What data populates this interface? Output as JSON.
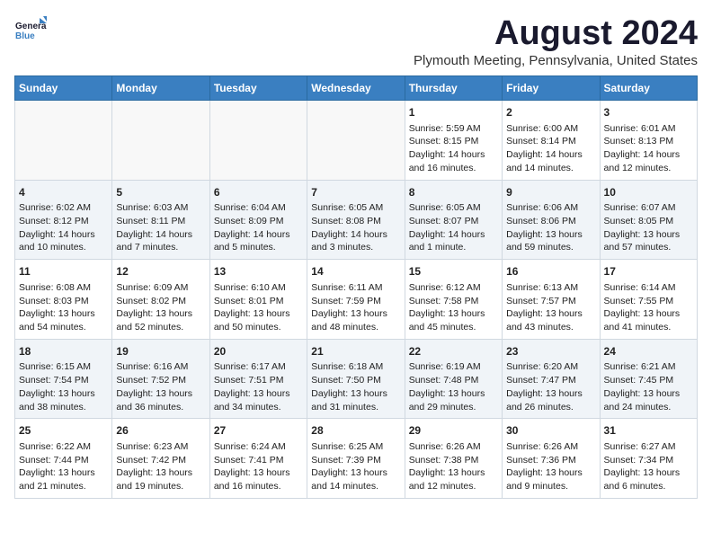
{
  "header": {
    "logo_general": "General",
    "logo_blue": "Blue",
    "title": "August 2024",
    "subtitle": "Plymouth Meeting, Pennsylvania, United States"
  },
  "columns": [
    "Sunday",
    "Monday",
    "Tuesday",
    "Wednesday",
    "Thursday",
    "Friday",
    "Saturday"
  ],
  "weeks": [
    [
      {
        "num": "",
        "content": ""
      },
      {
        "num": "",
        "content": ""
      },
      {
        "num": "",
        "content": ""
      },
      {
        "num": "",
        "content": ""
      },
      {
        "num": "1",
        "content": "Sunrise: 5:59 AM\nSunset: 8:15 PM\nDaylight: 14 hours\nand 16 minutes."
      },
      {
        "num": "2",
        "content": "Sunrise: 6:00 AM\nSunset: 8:14 PM\nDaylight: 14 hours\nand 14 minutes."
      },
      {
        "num": "3",
        "content": "Sunrise: 6:01 AM\nSunset: 8:13 PM\nDaylight: 14 hours\nand 12 minutes."
      }
    ],
    [
      {
        "num": "4",
        "content": "Sunrise: 6:02 AM\nSunset: 8:12 PM\nDaylight: 14 hours\nand 10 minutes."
      },
      {
        "num": "5",
        "content": "Sunrise: 6:03 AM\nSunset: 8:11 PM\nDaylight: 14 hours\nand 7 minutes."
      },
      {
        "num": "6",
        "content": "Sunrise: 6:04 AM\nSunset: 8:09 PM\nDaylight: 14 hours\nand 5 minutes."
      },
      {
        "num": "7",
        "content": "Sunrise: 6:05 AM\nSunset: 8:08 PM\nDaylight: 14 hours\nand 3 minutes."
      },
      {
        "num": "8",
        "content": "Sunrise: 6:05 AM\nSunset: 8:07 PM\nDaylight: 14 hours\nand 1 minute."
      },
      {
        "num": "9",
        "content": "Sunrise: 6:06 AM\nSunset: 8:06 PM\nDaylight: 13 hours\nand 59 minutes."
      },
      {
        "num": "10",
        "content": "Sunrise: 6:07 AM\nSunset: 8:05 PM\nDaylight: 13 hours\nand 57 minutes."
      }
    ],
    [
      {
        "num": "11",
        "content": "Sunrise: 6:08 AM\nSunset: 8:03 PM\nDaylight: 13 hours\nand 54 minutes."
      },
      {
        "num": "12",
        "content": "Sunrise: 6:09 AM\nSunset: 8:02 PM\nDaylight: 13 hours\nand 52 minutes."
      },
      {
        "num": "13",
        "content": "Sunrise: 6:10 AM\nSunset: 8:01 PM\nDaylight: 13 hours\nand 50 minutes."
      },
      {
        "num": "14",
        "content": "Sunrise: 6:11 AM\nSunset: 7:59 PM\nDaylight: 13 hours\nand 48 minutes."
      },
      {
        "num": "15",
        "content": "Sunrise: 6:12 AM\nSunset: 7:58 PM\nDaylight: 13 hours\nand 45 minutes."
      },
      {
        "num": "16",
        "content": "Sunrise: 6:13 AM\nSunset: 7:57 PM\nDaylight: 13 hours\nand 43 minutes."
      },
      {
        "num": "17",
        "content": "Sunrise: 6:14 AM\nSunset: 7:55 PM\nDaylight: 13 hours\nand 41 minutes."
      }
    ],
    [
      {
        "num": "18",
        "content": "Sunrise: 6:15 AM\nSunset: 7:54 PM\nDaylight: 13 hours\nand 38 minutes."
      },
      {
        "num": "19",
        "content": "Sunrise: 6:16 AM\nSunset: 7:52 PM\nDaylight: 13 hours\nand 36 minutes."
      },
      {
        "num": "20",
        "content": "Sunrise: 6:17 AM\nSunset: 7:51 PM\nDaylight: 13 hours\nand 34 minutes."
      },
      {
        "num": "21",
        "content": "Sunrise: 6:18 AM\nSunset: 7:50 PM\nDaylight: 13 hours\nand 31 minutes."
      },
      {
        "num": "22",
        "content": "Sunrise: 6:19 AM\nSunset: 7:48 PM\nDaylight: 13 hours\nand 29 minutes."
      },
      {
        "num": "23",
        "content": "Sunrise: 6:20 AM\nSunset: 7:47 PM\nDaylight: 13 hours\nand 26 minutes."
      },
      {
        "num": "24",
        "content": "Sunrise: 6:21 AM\nSunset: 7:45 PM\nDaylight: 13 hours\nand 24 minutes."
      }
    ],
    [
      {
        "num": "25",
        "content": "Sunrise: 6:22 AM\nSunset: 7:44 PM\nDaylight: 13 hours\nand 21 minutes."
      },
      {
        "num": "26",
        "content": "Sunrise: 6:23 AM\nSunset: 7:42 PM\nDaylight: 13 hours\nand 19 minutes."
      },
      {
        "num": "27",
        "content": "Sunrise: 6:24 AM\nSunset: 7:41 PM\nDaylight: 13 hours\nand 16 minutes."
      },
      {
        "num": "28",
        "content": "Sunrise: 6:25 AM\nSunset: 7:39 PM\nDaylight: 13 hours\nand 14 minutes."
      },
      {
        "num": "29",
        "content": "Sunrise: 6:26 AM\nSunset: 7:38 PM\nDaylight: 13 hours\nand 12 minutes."
      },
      {
        "num": "30",
        "content": "Sunrise: 6:26 AM\nSunset: 7:36 PM\nDaylight: 13 hours\nand 9 minutes."
      },
      {
        "num": "31",
        "content": "Sunrise: 6:27 AM\nSunset: 7:34 PM\nDaylight: 13 hours\nand 6 minutes."
      }
    ]
  ]
}
